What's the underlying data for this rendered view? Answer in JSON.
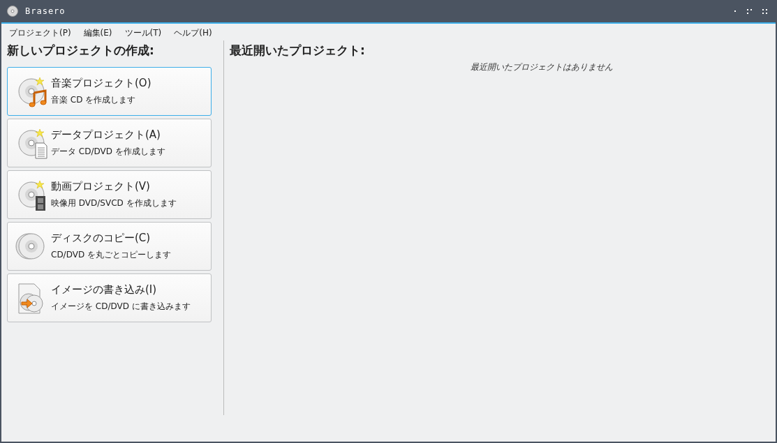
{
  "window": {
    "title": "Brasero"
  },
  "menu": [
    "プロジェクト(P)",
    "編集(E)",
    "ツール(T)",
    "ヘルプ(H)"
  ],
  "new_project": {
    "heading": "新しいプロジェクトの作成:",
    "items": [
      {
        "kind": "music",
        "title": "音楽プロジェクト(O)",
        "description": "音楽 CD を作成します",
        "selected": true
      },
      {
        "kind": "data",
        "title": "データプロジェクト(A)",
        "description": "データ CD/DVD を作成します",
        "selected": false
      },
      {
        "kind": "video",
        "title": "動画プロジェクト(V)",
        "description": "映像用 DVD/SVCD を作成します",
        "selected": false
      },
      {
        "kind": "copy",
        "title": "ディスクのコピー(C)",
        "description": "CD/DVD を丸ごとコピーします",
        "selected": false
      },
      {
        "kind": "image",
        "title": "イメージの書き込み(I)",
        "description": "イメージを CD/DVD に書き込みます",
        "selected": false
      }
    ]
  },
  "recent": {
    "heading": "最近開いたプロジェクト:",
    "empty_message": "最近開いたプロジェクトはありません"
  }
}
